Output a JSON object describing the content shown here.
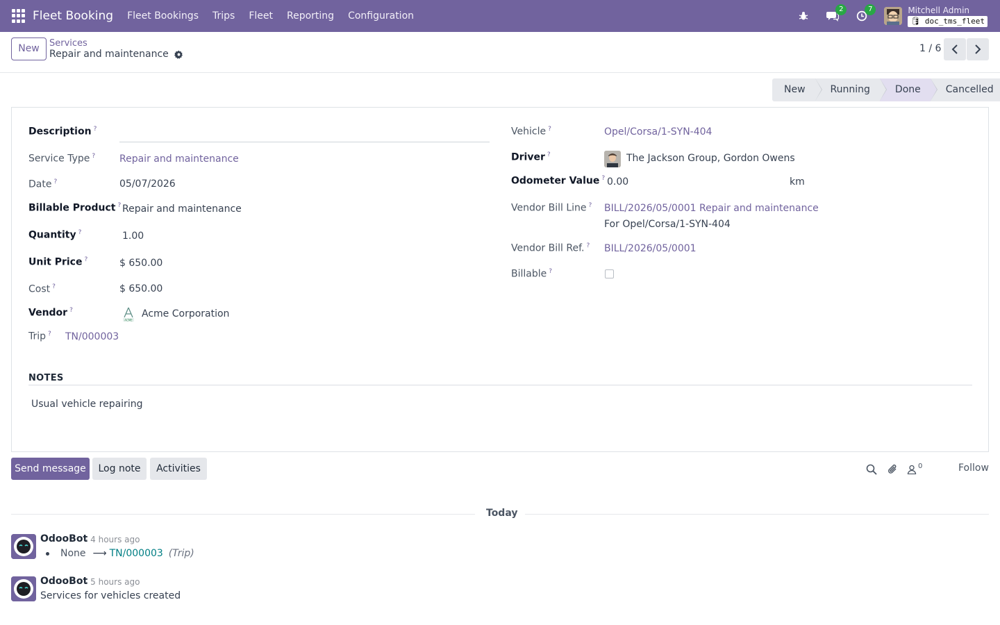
{
  "navbar": {
    "brand": "Fleet Booking",
    "menu": [
      "Fleet Bookings",
      "Trips",
      "Fleet",
      "Reporting",
      "Configuration"
    ],
    "messages_count": "2",
    "activities_count": "7",
    "user_name": "Mitchell Admin",
    "database": "doc_tms_fleet"
  },
  "control": {
    "new_label": "New",
    "breadcrumb_parent": "Services",
    "breadcrumb_current": "Repair and maintenance",
    "pager": "1 / 6"
  },
  "status": {
    "stages": [
      "New",
      "Running",
      "Done",
      "Cancelled"
    ],
    "active": "Done"
  },
  "form": {
    "left": {
      "description": {
        "label": "Description",
        "value": ""
      },
      "service_type": {
        "label": "Service Type",
        "value": "Repair and maintenance"
      },
      "date": {
        "label": "Date",
        "value": "05/07/2026"
      },
      "billable_product": {
        "label": "Billable Product",
        "value": "Repair and maintenance"
      },
      "quantity": {
        "label": "Quantity",
        "value": "1.00"
      },
      "unit_price": {
        "label": "Unit Price",
        "value": "$ 650.00"
      },
      "cost": {
        "label": "Cost",
        "value": "$ 650.00"
      },
      "vendor": {
        "label": "Vendor",
        "value": "Acme Corporation"
      },
      "trip": {
        "label": "Trip",
        "value": "TN/000003"
      }
    },
    "right": {
      "vehicle": {
        "label": "Vehicle",
        "value": "Opel/Corsa/1-SYN-404"
      },
      "driver": {
        "label": "Driver",
        "value": "The Jackson Group, Gordon Owens"
      },
      "odometer": {
        "label": "Odometer Value",
        "value": "0.00",
        "unit": "km"
      },
      "vendor_bill_line": {
        "label": "Vendor Bill Line",
        "value_line1": "BILL/2026/05/0001 Repair and maintenance",
        "value_line2": "For Opel/Corsa/1-SYN-404"
      },
      "vendor_bill_ref": {
        "label": "Vendor Bill Ref.",
        "value": "BILL/2026/05/0001"
      },
      "billable": {
        "label": "Billable",
        "checked": false
      }
    },
    "help_mark": "?",
    "notes": {
      "title": "NOTES",
      "text": "Usual vehicle repairing"
    }
  },
  "chatter": {
    "send_message": "Send message",
    "log_note": "Log note",
    "activities": "Activities",
    "followers_count": "0",
    "follow": "Follow",
    "day": "Today",
    "messages": [
      {
        "author": "OdooBot",
        "time": "- 4 hours ago",
        "tracking_old": "None",
        "tracking_arrow": "⟶",
        "tracking_new": "TN/000003",
        "tracking_field": "(Trip)"
      },
      {
        "author": "OdooBot",
        "time": "- 5 hours ago",
        "body": "Services for vehicles created"
      }
    ]
  },
  "colors": {
    "brand": "#71639e",
    "tracking_link": "#017e84",
    "success_badge": "#28a745"
  }
}
